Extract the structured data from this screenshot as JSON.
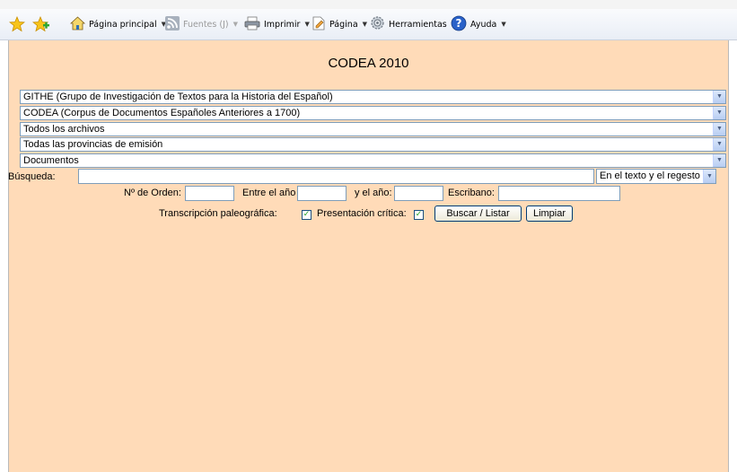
{
  "toolbar": {
    "home_label": "Página principal",
    "feeds_label": "Fuentes (J)",
    "print_label": "Imprimir",
    "page_label": "Página",
    "tools_label": "Herramientas",
    "help_label": "Ayuda"
  },
  "page": {
    "title": "CODEA 2010",
    "selects": [
      "GITHE (Grupo de Investigación de Textos para la Historia del Español)",
      "CODEA (Corpus de Documentos Españoles Anteriores a 1700)",
      "Todos los archivos",
      "Todas las provincias de emisión",
      "Documentos"
    ],
    "search_label": "Búsqueda:",
    "search_value": "",
    "search_scope": "En el texto y el regesto",
    "order_label": "Nº de Orden:",
    "order_value": "",
    "between_label": "Entre el año",
    "year_from_value": "",
    "and_year_label": "y el año:",
    "year_to_value": "",
    "scribe_label": "Escribano:",
    "scribe_value": "",
    "paleo_label": "Transcripción paleográfica:",
    "paleo_checked": true,
    "critica_label": "Presentación crítica:",
    "critica_checked": true,
    "search_button": "Buscar / Listar",
    "clear_button": "Limpiar"
  }
}
